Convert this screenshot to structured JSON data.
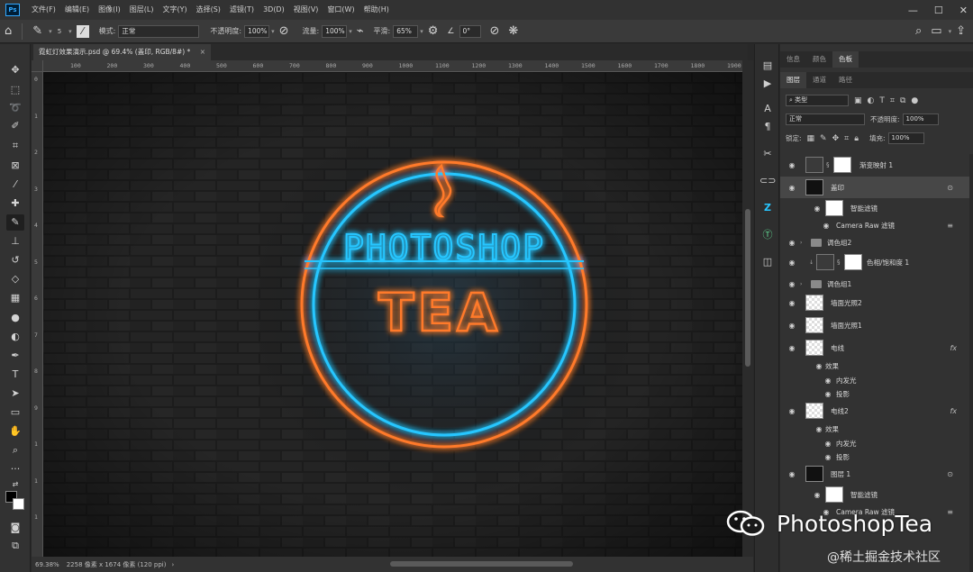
{
  "app": {
    "logo": "Ps",
    "menus": [
      "文件(F)",
      "编辑(E)",
      "图像(I)",
      "图层(L)",
      "文字(Y)",
      "选择(S)",
      "滤镜(T)",
      "3D(D)",
      "视图(V)",
      "窗口(W)",
      "帮助(H)"
    ]
  },
  "options": {
    "brush_size": "5",
    "mode_label": "模式:",
    "mode_value": "正常",
    "opacity_label": "不透明度:",
    "opacity_value": "100%",
    "flow_label": "流量:",
    "flow_value": "100%",
    "smooth_label": "平滑:",
    "smooth_value": "65%",
    "angle_value": "0°"
  },
  "document": {
    "tab_title": "霓虹灯效果演示.psd @ 69.4% (盖印, RGB/8#) *",
    "close": "×",
    "ruler_ticks": [
      "100",
      "200",
      "300",
      "400",
      "500",
      "600",
      "700",
      "800",
      "900",
      "1000",
      "1100",
      "1200",
      "1300",
      "1400",
      "1500",
      "1600",
      "1700",
      "1800",
      "1900"
    ],
    "ruler_left_ticks": [
      "0",
      "1",
      "2",
      "3",
      "4",
      "5",
      "6",
      "7",
      "8",
      "9",
      "1",
      "1",
      "1"
    ]
  },
  "canvas": {
    "line1": "PHOTOSHOP",
    "line2": "TEA",
    "colors": {
      "blue": "#27c6ff",
      "orange": "#ff7a2a",
      "background": "#1c1c1c"
    }
  },
  "status": {
    "zoom": "69.38%",
    "size": "2258 像素 x 1674 像素 (120 ppi)"
  },
  "panels": {
    "tabs_top": [
      "信息",
      "颜色",
      "色板"
    ],
    "tabs_layers": [
      "图层",
      "通道",
      "路径"
    ],
    "filter_value": "类型",
    "blend_value": "正常",
    "opacity_label": "不透明度:",
    "opacity_value": "100%",
    "lock_label": "锁定:",
    "fill_label": "填充:",
    "fill_value": "100%"
  },
  "layers": [
    {
      "name": "渐变映射 1",
      "type": "adjustment"
    },
    {
      "name": "盖印",
      "type": "smart",
      "selected": true
    },
    {
      "name": "智能滤镜",
      "type": "sub-thumb"
    },
    {
      "name": "Camera Raw 滤镜",
      "type": "sub"
    },
    {
      "name": "调色组2",
      "type": "group"
    },
    {
      "name": "色相/饱和度 1",
      "type": "adjustment2"
    },
    {
      "name": "调色组1",
      "type": "group"
    },
    {
      "name": "墙面光照2",
      "type": "normal"
    },
    {
      "name": "墙面光照1",
      "type": "normal"
    },
    {
      "name": "电线",
      "type": "fx"
    },
    {
      "name": "效果",
      "type": "effects"
    },
    {
      "name": "内发光",
      "type": "effect"
    },
    {
      "name": "投影",
      "type": "effect"
    },
    {
      "name": "电线2",
      "type": "fx"
    },
    {
      "name": "效果",
      "type": "effects"
    },
    {
      "name": "内发光",
      "type": "effect"
    },
    {
      "name": "投影",
      "type": "effect"
    },
    {
      "name": "图层 1",
      "type": "smart2"
    },
    {
      "name": "智能滤镜",
      "type": "sub-thumb"
    },
    {
      "name": "Camera Raw 滤镜",
      "type": "sub"
    }
  ],
  "watermark": {
    "brand": "PhotoshopTea",
    "juejin": "@稀土掘金技术社区"
  }
}
